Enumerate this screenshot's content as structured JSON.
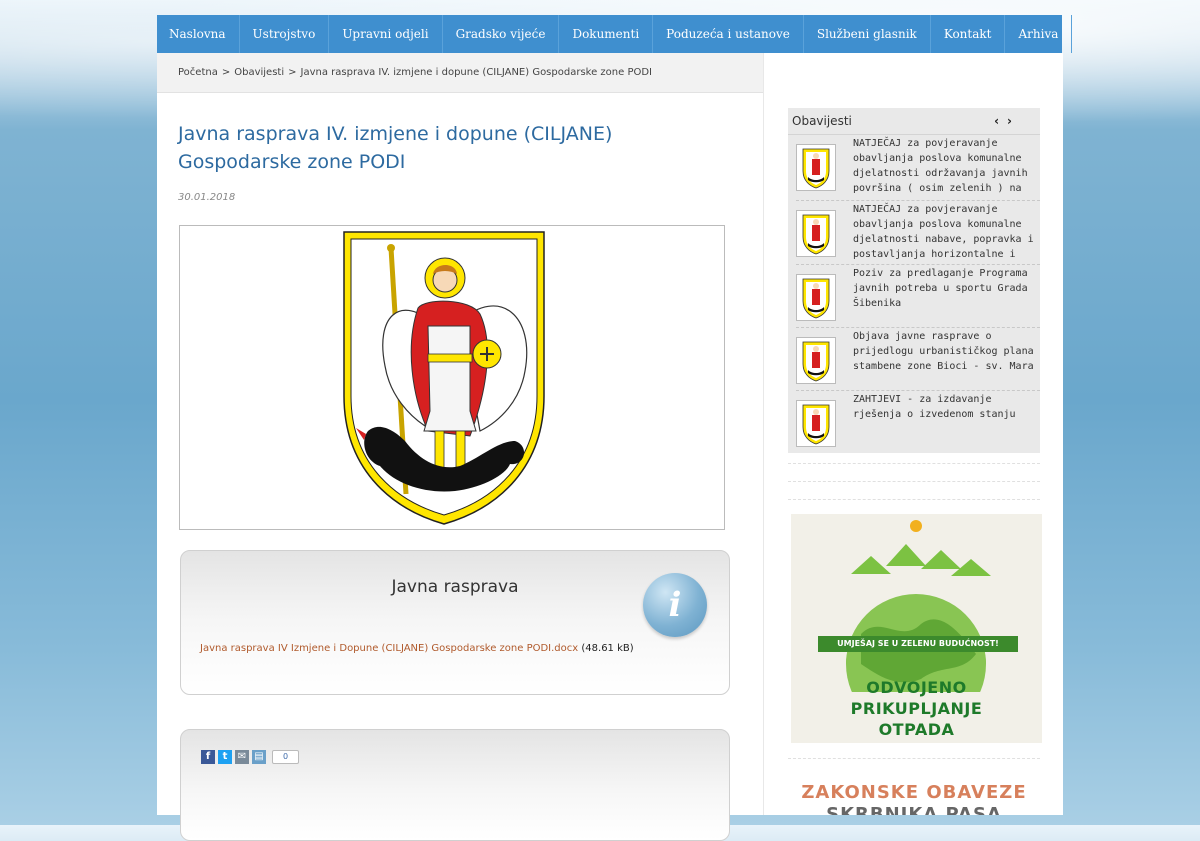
{
  "nav": {
    "items": [
      "Naslovna",
      "Ustrojstvo",
      "Upravni odjeli",
      "Gradsko vijeće",
      "Dokumenti",
      "Poduzeća i ustanove",
      "Službeni glasnik",
      "Kontakt",
      "Arhiva"
    ]
  },
  "breadcrumb": {
    "items": [
      "Početna",
      "Obavijesti",
      "Javna rasprava IV. izmjene i dopune (CILJANE) Gospodarske zone PODI"
    ],
    "separator": ">"
  },
  "article": {
    "title": "Javna rasprava IV. izmjene i dopune (CILJANE) Gospodarske zone PODI",
    "date": "30.01.2018",
    "image_icon": "coat-of-arms-icon"
  },
  "attachment_panel": {
    "title": "Javna rasprava",
    "icon": "info-icon",
    "file_link": "Javna rasprava IV Izmjene i Dopune (CILJANE) Gospodarske zone PODI.docx",
    "file_size": "(48.61 kB)"
  },
  "share": {
    "buttons": [
      "f",
      "t",
      "✉",
      "▤"
    ],
    "count": "0",
    "colors": {
      "facebook": "#3b5998",
      "twitter": "#1da1f2",
      "email": "#7a8a99",
      "print": "#6aa0c9"
    }
  },
  "sidebar": {
    "widget_title": "Obavijesti",
    "prev": "‹",
    "next": "›",
    "news": [
      "NATJEČAJ za povjeravanje obavljanja poslova komunalne djelatnosti održavanja javnih površina ( osim zelenih ) na",
      "NATJEČAJ za povjeravanje obavljanja poslova komunalne djelatnosti nabave, popravka i postavljanja horizontalne i",
      "Poziv za predlaganje Programa javnih potreba u sportu Grada Šibenika",
      "Objava javne rasprave o prijedlogu urbanističkog plana stambene zone Bioci - sv. Mara",
      "ZAHTJEVI - za izdavanje rješenja o izvedenom stanju"
    ],
    "eco_banner": {
      "slogan": "UMJEŠAJ SE U ZELENU BUDUĆNOST!",
      "line1": "ODVOJENO",
      "line2": "PRIKUPLJANJE",
      "line3": "OTPADA"
    },
    "law_banner": {
      "line1": "ZAKONSKE OBAVEZE",
      "line2": "SKRBNIKA PASA"
    }
  },
  "colors": {
    "nav": "#3f8fcf",
    "title": "#2d6aa0",
    "link": "#b05a2c",
    "eco_green": "#1e7a2a"
  }
}
